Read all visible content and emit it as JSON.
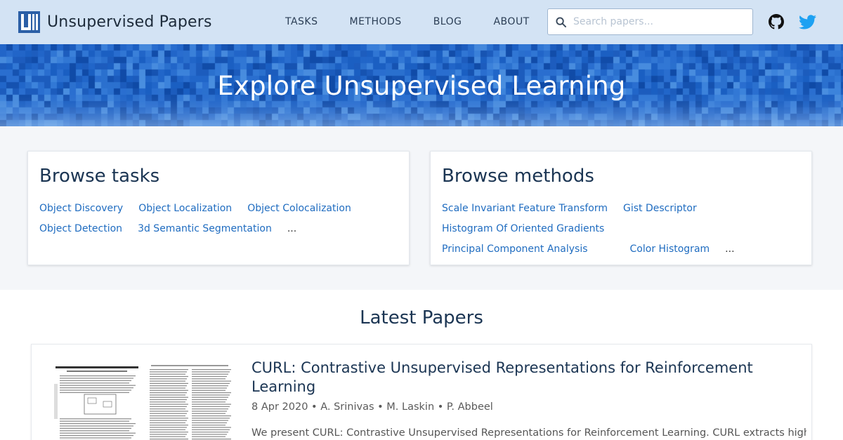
{
  "header": {
    "brand": "Unsupervised Papers",
    "nav": [
      "TASKS",
      "METHODS",
      "BLOG",
      "ABOUT"
    ],
    "search_placeholder": "Search papers...",
    "icons": [
      "logo-icon",
      "search-icon",
      "github-icon",
      "twitter-icon"
    ]
  },
  "hero": {
    "title": "Explore Unsupervised Learning"
  },
  "browse_tasks": {
    "title": "Browse tasks",
    "items": [
      "Object Discovery",
      "Object Localization",
      "Object Colocalization",
      "Object Detection",
      "3d Semantic Segmentation"
    ],
    "more": "..."
  },
  "browse_methods": {
    "title": "Browse methods",
    "items": [
      "Scale Invariant Feature Transform",
      "Gist Descriptor",
      "Histogram Of Oriented Gradients",
      "Principal Component Analysis",
      "Color Histogram"
    ],
    "more": "..."
  },
  "latest": {
    "title": "Latest Papers",
    "papers": [
      {
        "title": "CURL: Contrastive Unsupervised Representations for Reinforcement Learning",
        "date": "8 Apr 2020",
        "authors": [
          "A. Srinivas",
          "M. Laskin",
          "P. Abbeel"
        ],
        "meta": "8 Apr 2020 • A. Srinivas • M. Laskin • P. Abbeel",
        "abstract": "We present CURL: Contrastive Unsupervised Representations for Reinforcement Learning. CURL extracts high-"
      }
    ]
  },
  "colors": {
    "header_bg": "#d3e3f4",
    "hero_bg": "#1f66c8",
    "link": "#1f6cc0",
    "heading": "#1b3553"
  }
}
